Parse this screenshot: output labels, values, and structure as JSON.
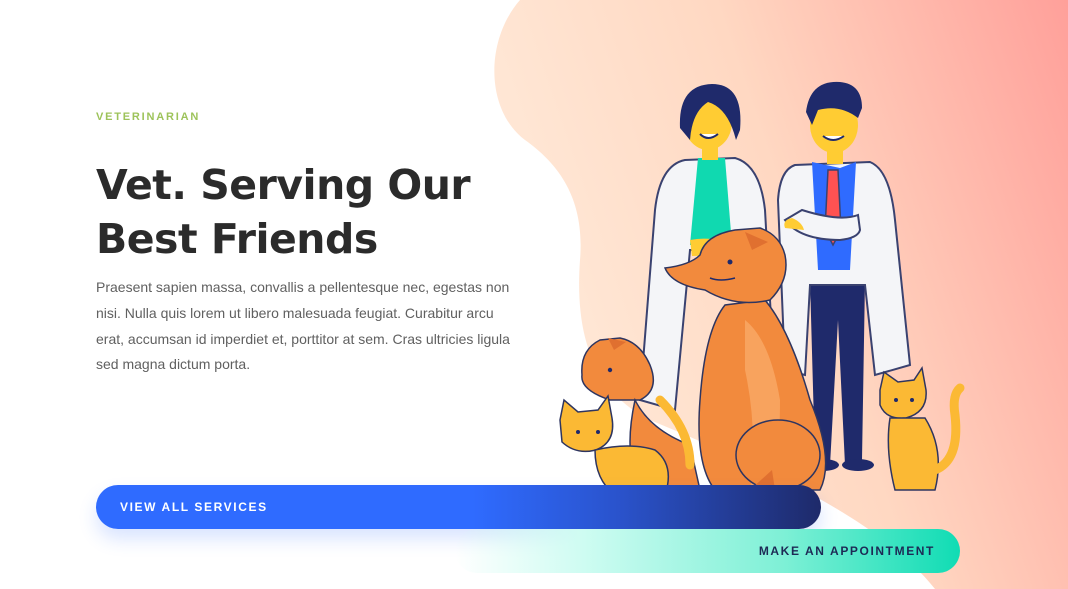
{
  "hero": {
    "eyebrow": "VETERINARIAN",
    "title": "Vet. Serving Our Best Friends",
    "description": "Praesent sapien massa, convallis a pellentesque nec, egestas non nisi. Nulla quis lorem ut libero malesuada feugiat. Curabitur arcu erat, accumsan id imperdiet et, porttitor at sem. Cras ultricies ligula sed magna dictum porta."
  },
  "buttons": {
    "primary_label": "VIEW ALL SERVICES",
    "secondary_label": "MAKE AN APPOINTMENT"
  },
  "colors": {
    "eyebrow": "#9dc35a",
    "title": "#2b2b2b",
    "body_text": "#606060",
    "primary_button": "#2f6bff",
    "secondary_button": "#10dcb4",
    "blob_light": "#ffe9d6",
    "blob_dark": "#ffa49c"
  },
  "illustration": {
    "icons": [
      "female-vet",
      "male-vet",
      "dog",
      "cat-left",
      "cat-right"
    ]
  }
}
